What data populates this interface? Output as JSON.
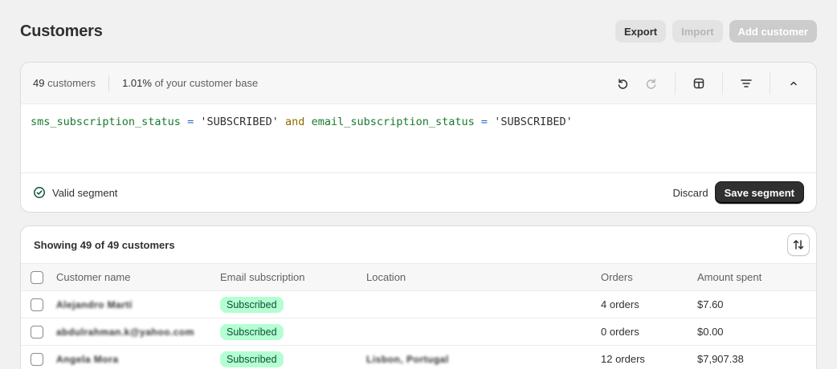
{
  "page": {
    "title": "Customers",
    "actions": {
      "export": "Export",
      "import": "Import",
      "add": "Add customer"
    }
  },
  "segment": {
    "count": "49",
    "count_label": "customers",
    "base_pct": "1.01%",
    "base_label": "of your customer base",
    "query": {
      "field1": "sms_subscription_status",
      "op1": "=",
      "value1": "'SUBSCRIBED'",
      "keyword": "and",
      "field2": "email_subscription_status",
      "op2": "=",
      "value2": "'SUBSCRIBED'"
    },
    "status": "Valid segment",
    "discard": "Discard",
    "save": "Save segment"
  },
  "table": {
    "heading": "Showing 49 of 49 customers",
    "columns": [
      "Customer name",
      "Email subscription",
      "Location",
      "Orders",
      "Amount spent"
    ],
    "rows": [
      {
        "name": "Alejandro Martí",
        "email_status": "Subscribed",
        "location": "",
        "orders": "4 orders",
        "amount": "$7.60"
      },
      {
        "name": "abdulrahman.k@yahoo.com",
        "email_status": "Subscribed",
        "location": "",
        "orders": "0 orders",
        "amount": "$0.00"
      },
      {
        "name": "Angela Mora",
        "email_status": "Subscribed",
        "location": "Lisbon, Portugal",
        "orders": "12 orders",
        "amount": "$7,907.38"
      }
    ]
  },
  "colors": {
    "badge_bg": "#b4fed2",
    "badge_text": "#0c5132",
    "primary": "#303030",
    "valid": "#0c5132"
  }
}
